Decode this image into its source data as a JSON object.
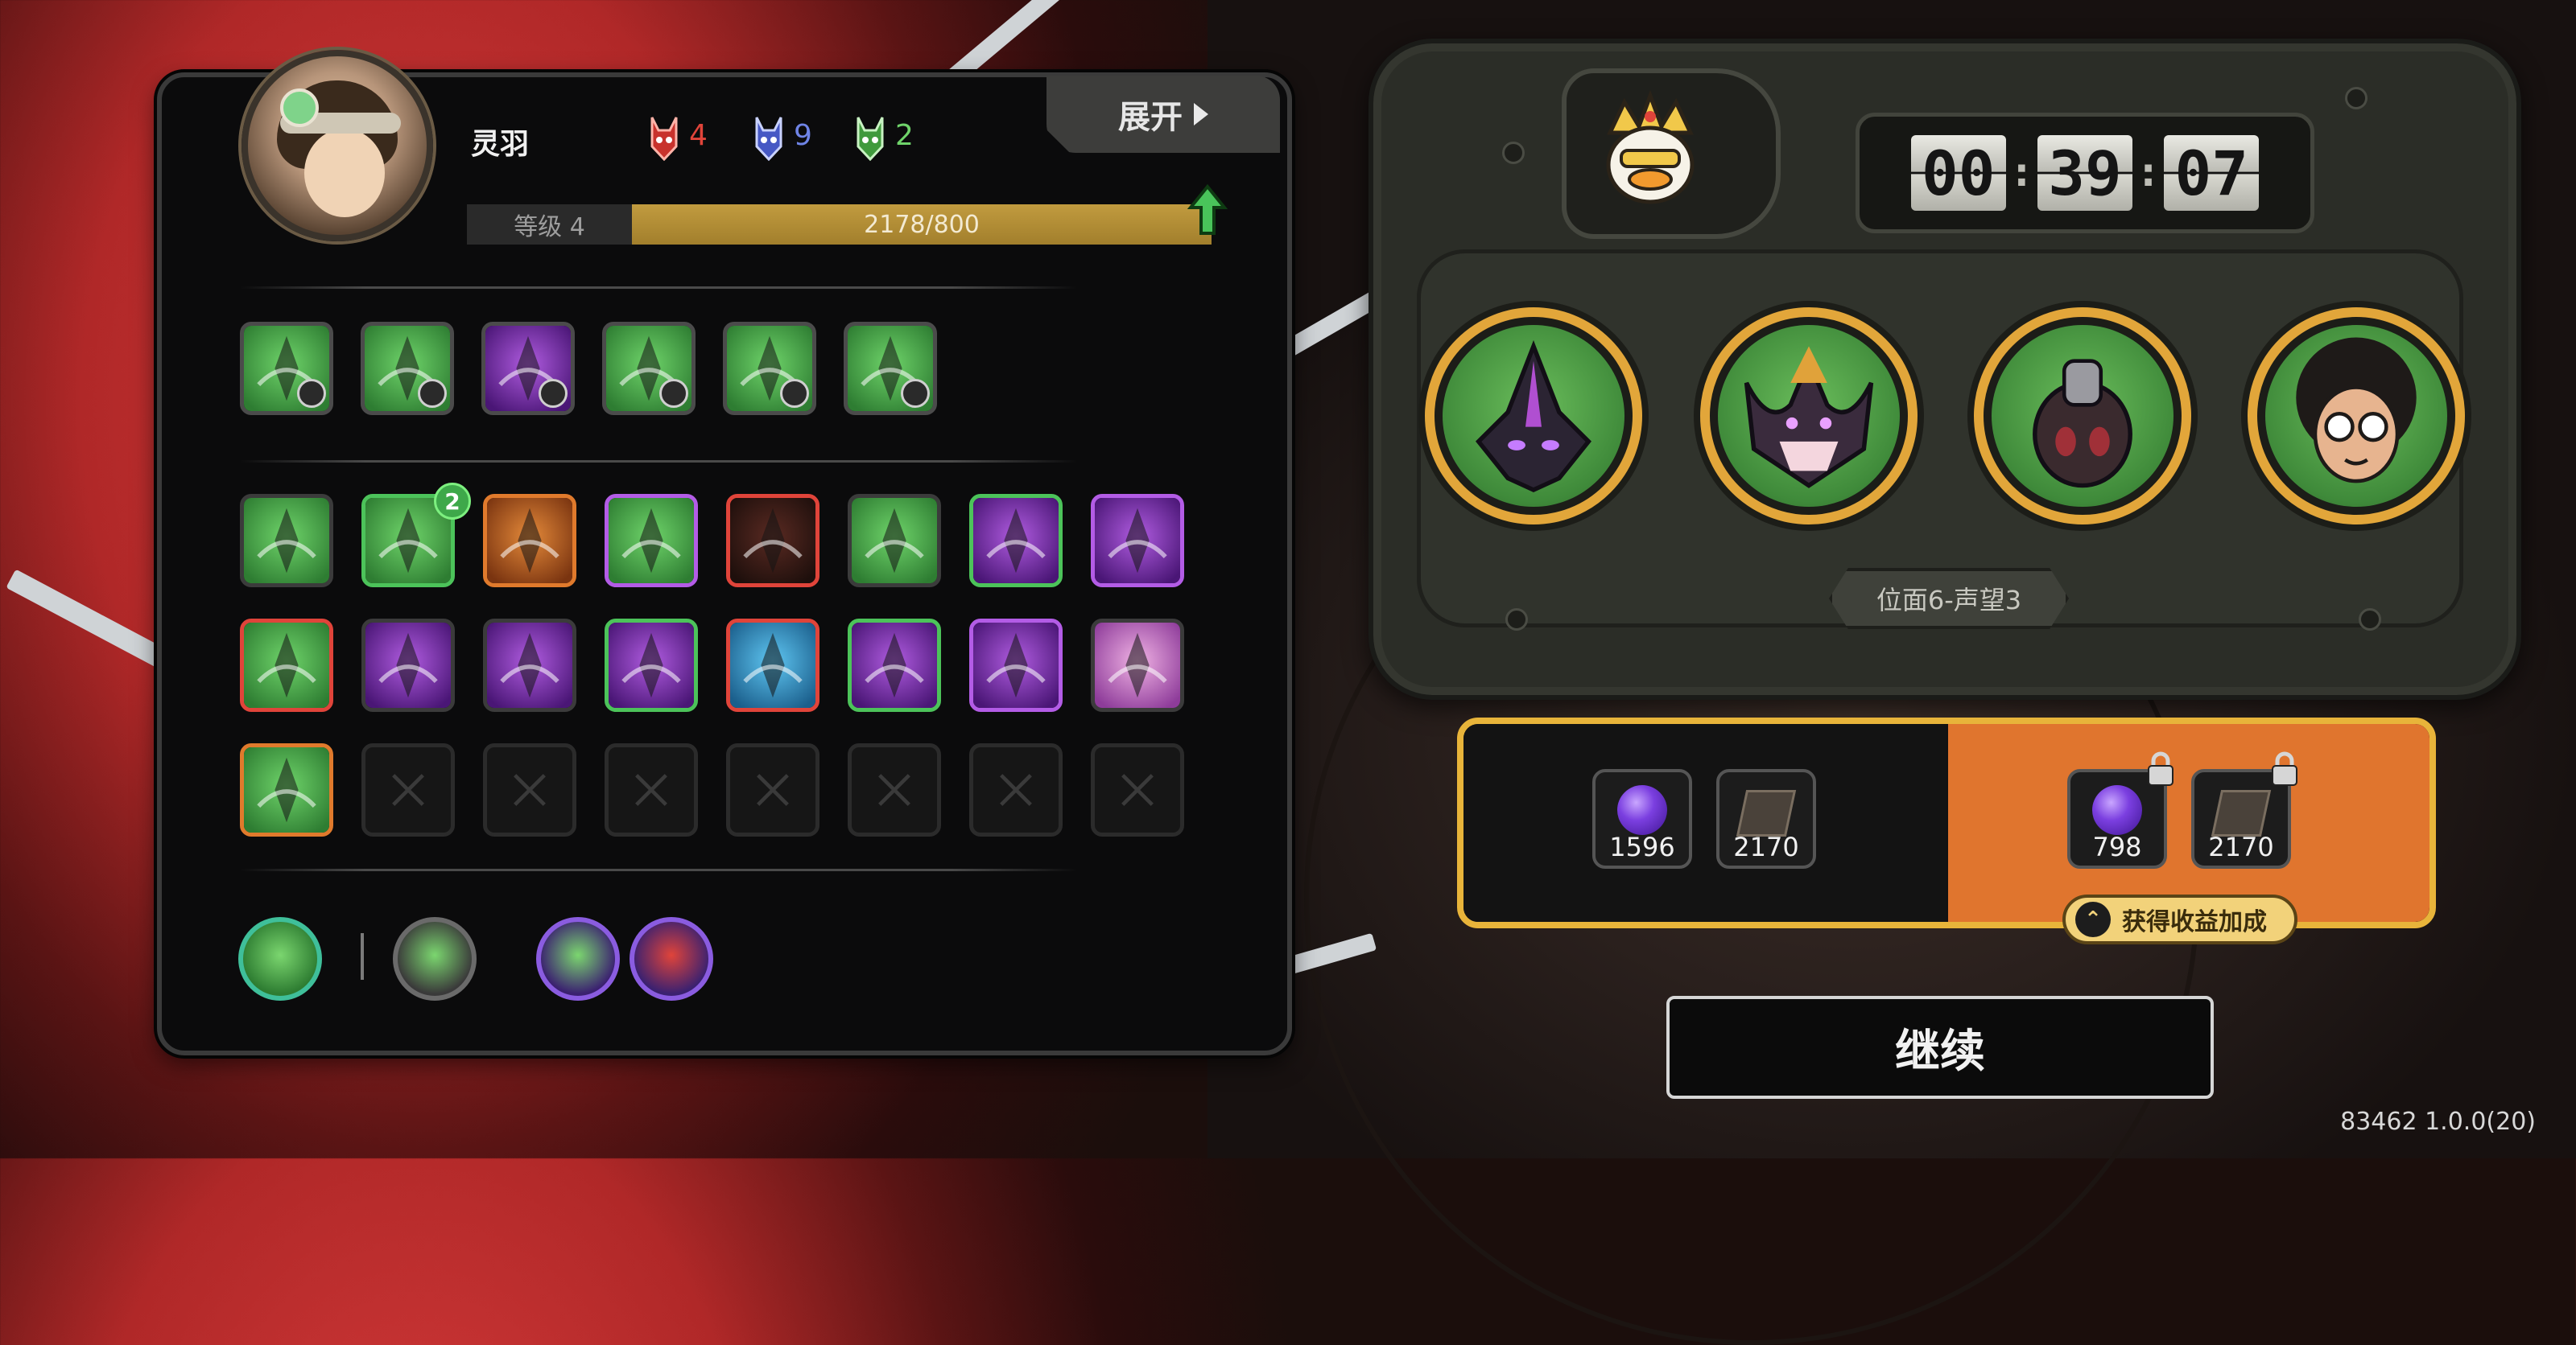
{
  "hero": {
    "name": "灵羽",
    "level_label": "等级 4",
    "xp_text": "2178/800",
    "expand_label": "展开"
  },
  "factions": [
    {
      "icon": "red-mask-icon",
      "count": "4",
      "color": "#e0443a"
    },
    {
      "icon": "blue-mask-icon",
      "count": "9",
      "color": "#6f84e6"
    },
    {
      "icon": "green-mask-icon",
      "count": "2",
      "color": "#6fd36a"
    }
  ],
  "skills_row": [
    {
      "icon": "green-blade-skill-icon",
      "badge": "shield"
    },
    {
      "icon": "green-arrow-burst-skill-icon",
      "badge": "shield"
    },
    {
      "icon": "purple-flame-skill-icon",
      "badge": "fire"
    },
    {
      "icon": "green-leaf-skill-icon",
      "badge": "sun"
    },
    {
      "icon": "green-vines-skill-icon",
      "badge": "moon"
    },
    {
      "icon": "green-helmet-skill-icon",
      "badge": "shield"
    }
  ],
  "inventory": [
    {
      "icon": "green-wings-icon",
      "border": "#3b3b3b",
      "theme": "green"
    },
    {
      "icon": "green-crystal-icon",
      "border": "#4cc35a",
      "theme": "green",
      "count": "2"
    },
    {
      "icon": "gold-helmet-icon",
      "border": "#e07a2c",
      "theme": "orange"
    },
    {
      "icon": "green-bullet-icon",
      "border": "#b35ce6",
      "theme": "green"
    },
    {
      "icon": "bullets-icon",
      "border": "#e0443a",
      "theme": "dark"
    },
    {
      "icon": "green-thorns-icon",
      "border": "#3b3b3b",
      "theme": "green"
    },
    {
      "icon": "purple-claw-icon",
      "border": "#4cc35a",
      "theme": "purple"
    },
    {
      "icon": "purple-crown-icon",
      "border": "#b35ce6",
      "theme": "purple"
    },
    {
      "icon": "green-spears-icon",
      "border": "#e0443a",
      "theme": "green"
    },
    {
      "icon": "purple-urchin-icon",
      "border": "#3b3b3b",
      "theme": "purple"
    },
    {
      "icon": "purple-spine-icon",
      "border": "#3b3b3b",
      "theme": "purple"
    },
    {
      "icon": "purple-hand-icon",
      "border": "#4cc35a",
      "theme": "purple"
    },
    {
      "icon": "blue-star-icon",
      "border": "#e0443a",
      "theme": "blue"
    },
    {
      "icon": "purple-veins-icon",
      "border": "#4cc35a",
      "theme": "purple"
    },
    {
      "icon": "purple-slime-icon",
      "border": "#b35ce6",
      "theme": "purple"
    },
    {
      "icon": "pink-eye-icon",
      "border": "#3b3b3b",
      "theme": "pink"
    },
    {
      "icon": "green-swirl-icon",
      "border": "#e07a2c",
      "theme": "green"
    },
    {
      "icon": "empty-slot-icon",
      "empty": true
    },
    {
      "icon": "empty-slot-icon",
      "empty": true
    },
    {
      "icon": "empty-slot-icon",
      "empty": true
    },
    {
      "icon": "empty-slot-icon",
      "empty": true
    },
    {
      "icon": "empty-slot-icon",
      "empty": true
    },
    {
      "icon": "empty-slot-icon",
      "empty": true
    },
    {
      "icon": "empty-slot-icon",
      "empty": true
    }
  ],
  "round_skills": [
    {
      "icon": "green-slash-skill-icon"
    },
    {
      "icon": "green-fan-skill-icon"
    },
    {
      "icon": "gold-knight-skill-icon"
    },
    {
      "icon": "red-fist-skill-icon"
    }
  ],
  "timer": {
    "h": "00",
    "m": "39",
    "s": "07"
  },
  "boss_icon": "duck-king-icon",
  "enemies": [
    {
      "icon": "dark-hooded-enemy-icon"
    },
    {
      "icon": "horned-demon-enemy-icon"
    },
    {
      "icon": "armored-beetle-enemy-icon"
    },
    {
      "icon": "afro-glasses-enemy-icon"
    }
  ],
  "stage_label": "位面6-声望3",
  "rewards": {
    "base": [
      {
        "icon": "purple-orb-icon",
        "qty": "1596"
      },
      {
        "icon": "book-icon",
        "qty": "2170"
      }
    ],
    "bonus": [
      {
        "icon": "purple-orb-icon",
        "qty": "798",
        "locked": true
      },
      {
        "icon": "book-icon",
        "qty": "2170",
        "locked": true
      }
    ],
    "bonus_label": "获得收益加成"
  },
  "continue_label": "继续",
  "version": "83462 1.0.0(20)"
}
